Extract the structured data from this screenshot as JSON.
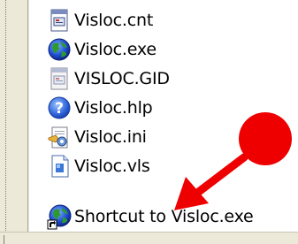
{
  "files": [
    {
      "name": "Visloc.cnt",
      "icon": "help-contents-file-icon"
    },
    {
      "name": "Visloc.exe",
      "icon": "globe-app-icon"
    },
    {
      "name": "VISLOC.GID",
      "icon": "gid-file-icon"
    },
    {
      "name": "Visloc.hlp",
      "icon": "help-file-icon"
    },
    {
      "name": "Visloc.ini",
      "icon": "settings-file-icon"
    },
    {
      "name": "Visloc.vls",
      "icon": "document-file-icon"
    },
    {
      "name": "Shortcut to Visloc.exe",
      "icon": "globe-shortcut-icon"
    }
  ],
  "colors": {
    "annotation_red": "#ee0000",
    "pane_bg": "#ece9d8"
  }
}
